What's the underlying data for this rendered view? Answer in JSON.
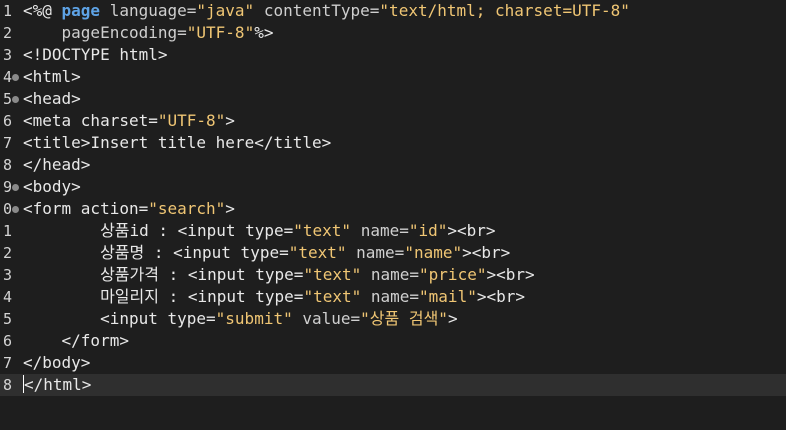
{
  "editor": {
    "current_line_index": 17,
    "colors": {
      "background": "#1e1e1e",
      "current_line": "#2f2f2f",
      "text": "#e8e8e8",
      "string": "#f0c674",
      "keyword": "#5ea3e6"
    },
    "lines": [
      {
        "num": "1",
        "fold": false,
        "tokens": [
          {
            "t": "<%@ ",
            "k": "plain"
          },
          {
            "t": "page",
            "k": "kw"
          },
          {
            "t": " language=",
            "k": "attr"
          },
          {
            "t": "\"java\"",
            "k": "str"
          },
          {
            "t": " contentType=",
            "k": "attr"
          },
          {
            "t": "\"text/html; charset=UTF-8\"",
            "k": "str"
          }
        ]
      },
      {
        "num": "2",
        "fold": false,
        "tokens": [
          {
            "t": "    pageEncoding=",
            "k": "attr"
          },
          {
            "t": "\"UTF-8\"",
            "k": "str"
          },
          {
            "t": "%>",
            "k": "plain"
          }
        ]
      },
      {
        "num": "3",
        "fold": false,
        "tokens": [
          {
            "t": "<!DOCTYPE html>",
            "k": "tag"
          }
        ]
      },
      {
        "num": "4",
        "fold": true,
        "tokens": [
          {
            "t": "<html>",
            "k": "tag"
          }
        ]
      },
      {
        "num": "5",
        "fold": true,
        "tokens": [
          {
            "t": "<head>",
            "k": "tag"
          }
        ]
      },
      {
        "num": "6",
        "fold": false,
        "tokens": [
          {
            "t": "<meta charset=",
            "k": "tag"
          },
          {
            "t": "\"UTF-8\"",
            "k": "str"
          },
          {
            "t": ">",
            "k": "tag"
          }
        ]
      },
      {
        "num": "7",
        "fold": false,
        "tokens": [
          {
            "t": "<title>",
            "k": "tag"
          },
          {
            "t": "Insert title here",
            "k": "plain"
          },
          {
            "t": "</title>",
            "k": "tag"
          }
        ]
      },
      {
        "num": "8",
        "fold": false,
        "tokens": [
          {
            "t": "</head>",
            "k": "tag"
          }
        ]
      },
      {
        "num": "9",
        "fold": true,
        "tokens": [
          {
            "t": "<body>",
            "k": "tag"
          }
        ]
      },
      {
        "num": "0",
        "fold": true,
        "tokens": [
          {
            "t": "<form action=",
            "k": "tag"
          },
          {
            "t": "\"search\"",
            "k": "str"
          },
          {
            "t": ">",
            "k": "tag"
          }
        ]
      },
      {
        "num": "1",
        "fold": false,
        "tokens": [
          {
            "t": "        상품id : ",
            "k": "plain"
          },
          {
            "t": "<input type=",
            "k": "tag"
          },
          {
            "t": "\"text\"",
            "k": "str"
          },
          {
            "t": " name=",
            "k": "attr"
          },
          {
            "t": "\"id\"",
            "k": "str"
          },
          {
            "t": "><br>",
            "k": "tag"
          }
        ]
      },
      {
        "num": "2",
        "fold": false,
        "tokens": [
          {
            "t": "        상품명 : ",
            "k": "plain"
          },
          {
            "t": "<input type=",
            "k": "tag"
          },
          {
            "t": "\"text\"",
            "k": "str"
          },
          {
            "t": " name=",
            "k": "attr"
          },
          {
            "t": "\"name\"",
            "k": "str"
          },
          {
            "t": "><br>",
            "k": "tag"
          }
        ]
      },
      {
        "num": "3",
        "fold": false,
        "tokens": [
          {
            "t": "        상품가격 : ",
            "k": "plain"
          },
          {
            "t": "<input type=",
            "k": "tag"
          },
          {
            "t": "\"text\"",
            "k": "str"
          },
          {
            "t": " name=",
            "k": "attr"
          },
          {
            "t": "\"price\"",
            "k": "str"
          },
          {
            "t": "><br>",
            "k": "tag"
          }
        ]
      },
      {
        "num": "4",
        "fold": false,
        "tokens": [
          {
            "t": "        마일리지 : ",
            "k": "plain"
          },
          {
            "t": "<input type=",
            "k": "tag"
          },
          {
            "t": "\"text\"",
            "k": "str"
          },
          {
            "t": " name=",
            "k": "attr"
          },
          {
            "t": "\"mail\"",
            "k": "str"
          },
          {
            "t": "><br>",
            "k": "tag"
          }
        ]
      },
      {
        "num": "5",
        "fold": false,
        "tokens": [
          {
            "t": "        <input type=",
            "k": "tag"
          },
          {
            "t": "\"submit\"",
            "k": "str"
          },
          {
            "t": " value=",
            "k": "attr"
          },
          {
            "t": "\"상품 검색\"",
            "k": "str"
          },
          {
            "t": ">",
            "k": "tag"
          }
        ]
      },
      {
        "num": "6",
        "fold": false,
        "tokens": [
          {
            "t": "    </form>",
            "k": "tag"
          }
        ]
      },
      {
        "num": "7",
        "fold": false,
        "tokens": [
          {
            "t": "</body>",
            "k": "tag"
          }
        ]
      },
      {
        "num": "8",
        "fold": false,
        "tokens": [
          {
            "t": "</html>",
            "k": "tag"
          }
        ]
      }
    ]
  }
}
